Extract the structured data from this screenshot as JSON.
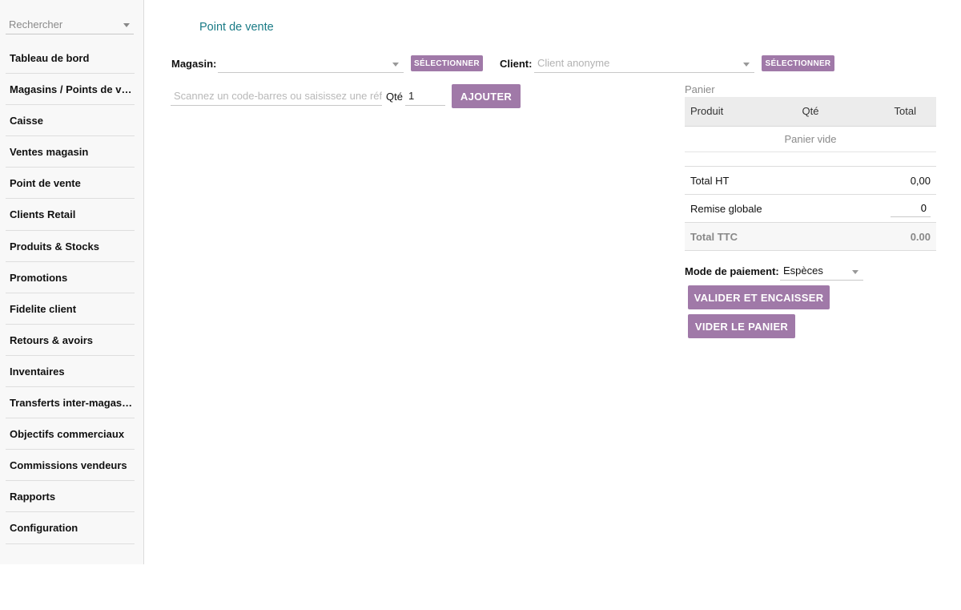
{
  "sidebar": {
    "search_placeholder": "Rechercher",
    "items": [
      {
        "label": "Tableau de bord"
      },
      {
        "label": "Magasins / Points de vente"
      },
      {
        "label": "Caisse"
      },
      {
        "label": "Ventes magasin"
      },
      {
        "label": "Point de vente"
      },
      {
        "label": "Clients Retail"
      },
      {
        "label": "Produits & Stocks"
      },
      {
        "label": "Promotions"
      },
      {
        "label": "Fidelite client"
      },
      {
        "label": "Retours & avoirs"
      },
      {
        "label": "Inventaires"
      },
      {
        "label": "Transferts inter-magasins"
      },
      {
        "label": "Objectifs commerciaux"
      },
      {
        "label": "Commissions vendeurs"
      },
      {
        "label": "Rapports"
      },
      {
        "label": "Configuration"
      }
    ]
  },
  "main": {
    "title": "Point de vente",
    "store": {
      "label": "Magasin:",
      "value": "",
      "select_label": "SÉLECTIONNER"
    },
    "client": {
      "label": "Client:",
      "placeholder": "Client anonyme",
      "select_label": "SÉLECTIONNER"
    },
    "scan": {
      "placeholder": "Scannez un code-barres ou saisissez une référence",
      "qty_label": "Qté",
      "qty_value": "1",
      "add_label": "AJOUTER"
    }
  },
  "cart": {
    "caption": "Panier",
    "columns": [
      "Produit",
      "Qté",
      "Total"
    ],
    "empty_text": "Panier vide",
    "totals": {
      "ht_label": "Total HT",
      "ht_value": "0,00",
      "discount_label": "Remise globale",
      "discount_value": "0",
      "ttc_label": "Total TTC",
      "ttc_value": "0.00"
    },
    "payment": {
      "label": "Mode de paiement:",
      "value": "Espèces"
    },
    "validate_label": "VALIDER ET ENCAISSER",
    "clear_label": "VIDER LE PANIER"
  },
  "colors": {
    "accent": "#a079a8",
    "title": "#1a7b86"
  }
}
